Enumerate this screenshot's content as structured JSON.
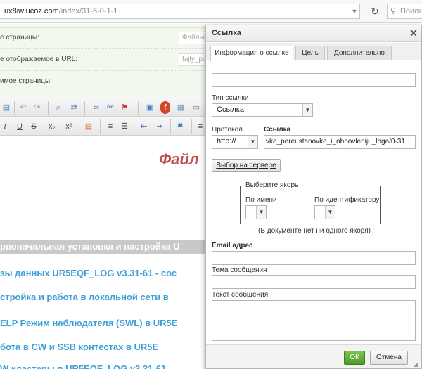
{
  "browser": {
    "url_host": "ux8iw.ucoz.com",
    "url_path": "/index/31-5-0-1-1",
    "search_placeholder": "Поиск"
  },
  "form": {
    "row1_label": "е страницы:",
    "row1_value": "Файлы",
    "row2_label": "е отображаемое в URL:",
    "row2_value": "fajly_po",
    "row3_label": "имое страницы:"
  },
  "editor": {
    "title": "Файл",
    "lines": [
      "рвоначальная установка и настройка U",
      "зы данных UR5EQF_LOG  v3.31-61 - сос",
      "стройка и работа в локальной сети  в",
      "ELP Режим наблюдателя (SWL) в  UR5E",
      "бота в CW и SSB контестах в UR5E",
      "W кластеры в UR5EQF_LOG v3.31-61"
    ]
  },
  "dialog": {
    "title": "Ссылка",
    "tabs": [
      "Информация о ссылке",
      "Цель",
      "Дополнительно"
    ],
    "display_text_value": "",
    "link_type_label": "Тип ссылки",
    "link_type_value": "Ссылка",
    "protocol_label": "Протокол",
    "protocol_value": "http://",
    "link_label": "Ссылка",
    "link_value": "vke_pereustanovke_i_obnovleniju_loga/0-31",
    "browse_server_label": "Выбор на сервере",
    "anchor_legend": "Выберите якорь",
    "by_name_label": "По имени",
    "by_id_label": "По идентификатору",
    "no_anchors_text": "(В документе нет ни одного якоря)",
    "email_label": "Email адрес",
    "subject_label": "Тема сообщения",
    "message_label": "Текст сообщения",
    "ok_label": "ОК",
    "cancel_label": "Отмена"
  },
  "colors": {
    "ok_green": "#4e9a2a",
    "title_red": "#c05050",
    "link_blue": "#3fa0d9"
  }
}
